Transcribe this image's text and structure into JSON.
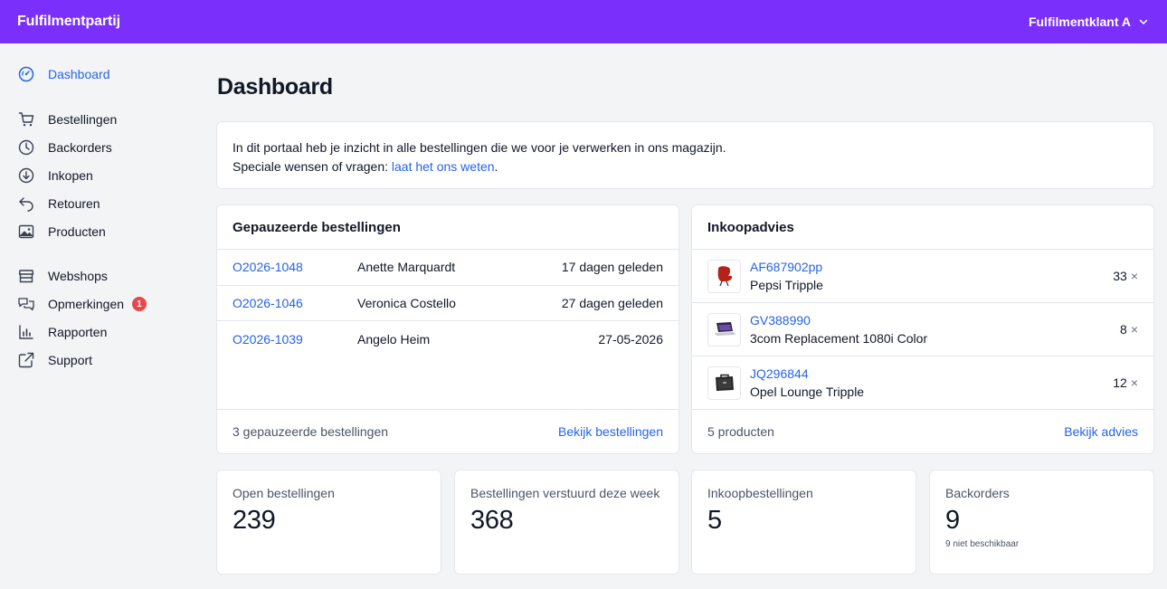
{
  "header": {
    "brand": "Fulfilmentpartij",
    "account": "Fulfilmentklant A"
  },
  "sidebar": {
    "items": [
      {
        "label": "Dashboard",
        "icon": "dashboard-gauge-icon"
      },
      {
        "label": "Bestellingen",
        "icon": "cart-icon"
      },
      {
        "label": "Backorders",
        "icon": "clock-icon"
      },
      {
        "label": "Inkopen",
        "icon": "download-circle-icon"
      },
      {
        "label": "Retouren",
        "icon": "return-arrow-icon"
      },
      {
        "label": "Producten",
        "icon": "image-icon"
      },
      {
        "label": "Webshops",
        "icon": "store-icon"
      },
      {
        "label": "Opmerkingen",
        "icon": "chat-icon",
        "badge": "1"
      },
      {
        "label": "Rapporten",
        "icon": "bar-chart-icon"
      },
      {
        "label": "Support",
        "icon": "external-link-icon"
      }
    ]
  },
  "page": {
    "title": "Dashboard"
  },
  "intro": {
    "line1": "In dit portaal heb je inzicht in alle bestellingen die we voor je verwerken in ons magazijn.",
    "line2_prefix": "Speciale wensen of vragen: ",
    "line2_link": "laat het ons weten",
    "line2_suffix": "."
  },
  "paused": {
    "title": "Gepauzeerde bestellingen",
    "rows": [
      {
        "id": "O2026-1048",
        "name": "Anette Marquardt",
        "date": "17 dagen geleden"
      },
      {
        "id": "O2026-1046",
        "name": "Veronica Costello",
        "date": "27 dagen geleden"
      },
      {
        "id": "O2026-1039",
        "name": "Angelo Heim",
        "date": "27-05-2026"
      }
    ],
    "footer_count": "3 gepauzeerde bestellingen",
    "footer_link": "Bekijk bestellingen"
  },
  "advice": {
    "title": "Inkoopadvies",
    "rows": [
      {
        "sku": "AF687902pp",
        "name": "Pepsi Tripple",
        "qty": "33",
        "x": "×"
      },
      {
        "sku": "GV388990",
        "name": "3com Replacement 1080i Color",
        "qty": "8",
        "x": "×"
      },
      {
        "sku": "JQ296844",
        "name": "Opel Lounge Tripple",
        "qty": "12",
        "x": "×"
      }
    ],
    "footer_count": "5 producten",
    "footer_link": "Bekijk advies"
  },
  "stats": [
    {
      "label": "Open bestellingen",
      "value": "239"
    },
    {
      "label": "Bestellingen verstuurd deze week",
      "value": "368"
    },
    {
      "label": "Inkoopbestellingen",
      "value": "5"
    },
    {
      "label": "Backorders",
      "value": "9",
      "sub": "9 niet beschikbaar"
    }
  ],
  "colors": {
    "brand": "#7a2ffb",
    "link": "#2563eb",
    "badge": "#e5484d"
  }
}
